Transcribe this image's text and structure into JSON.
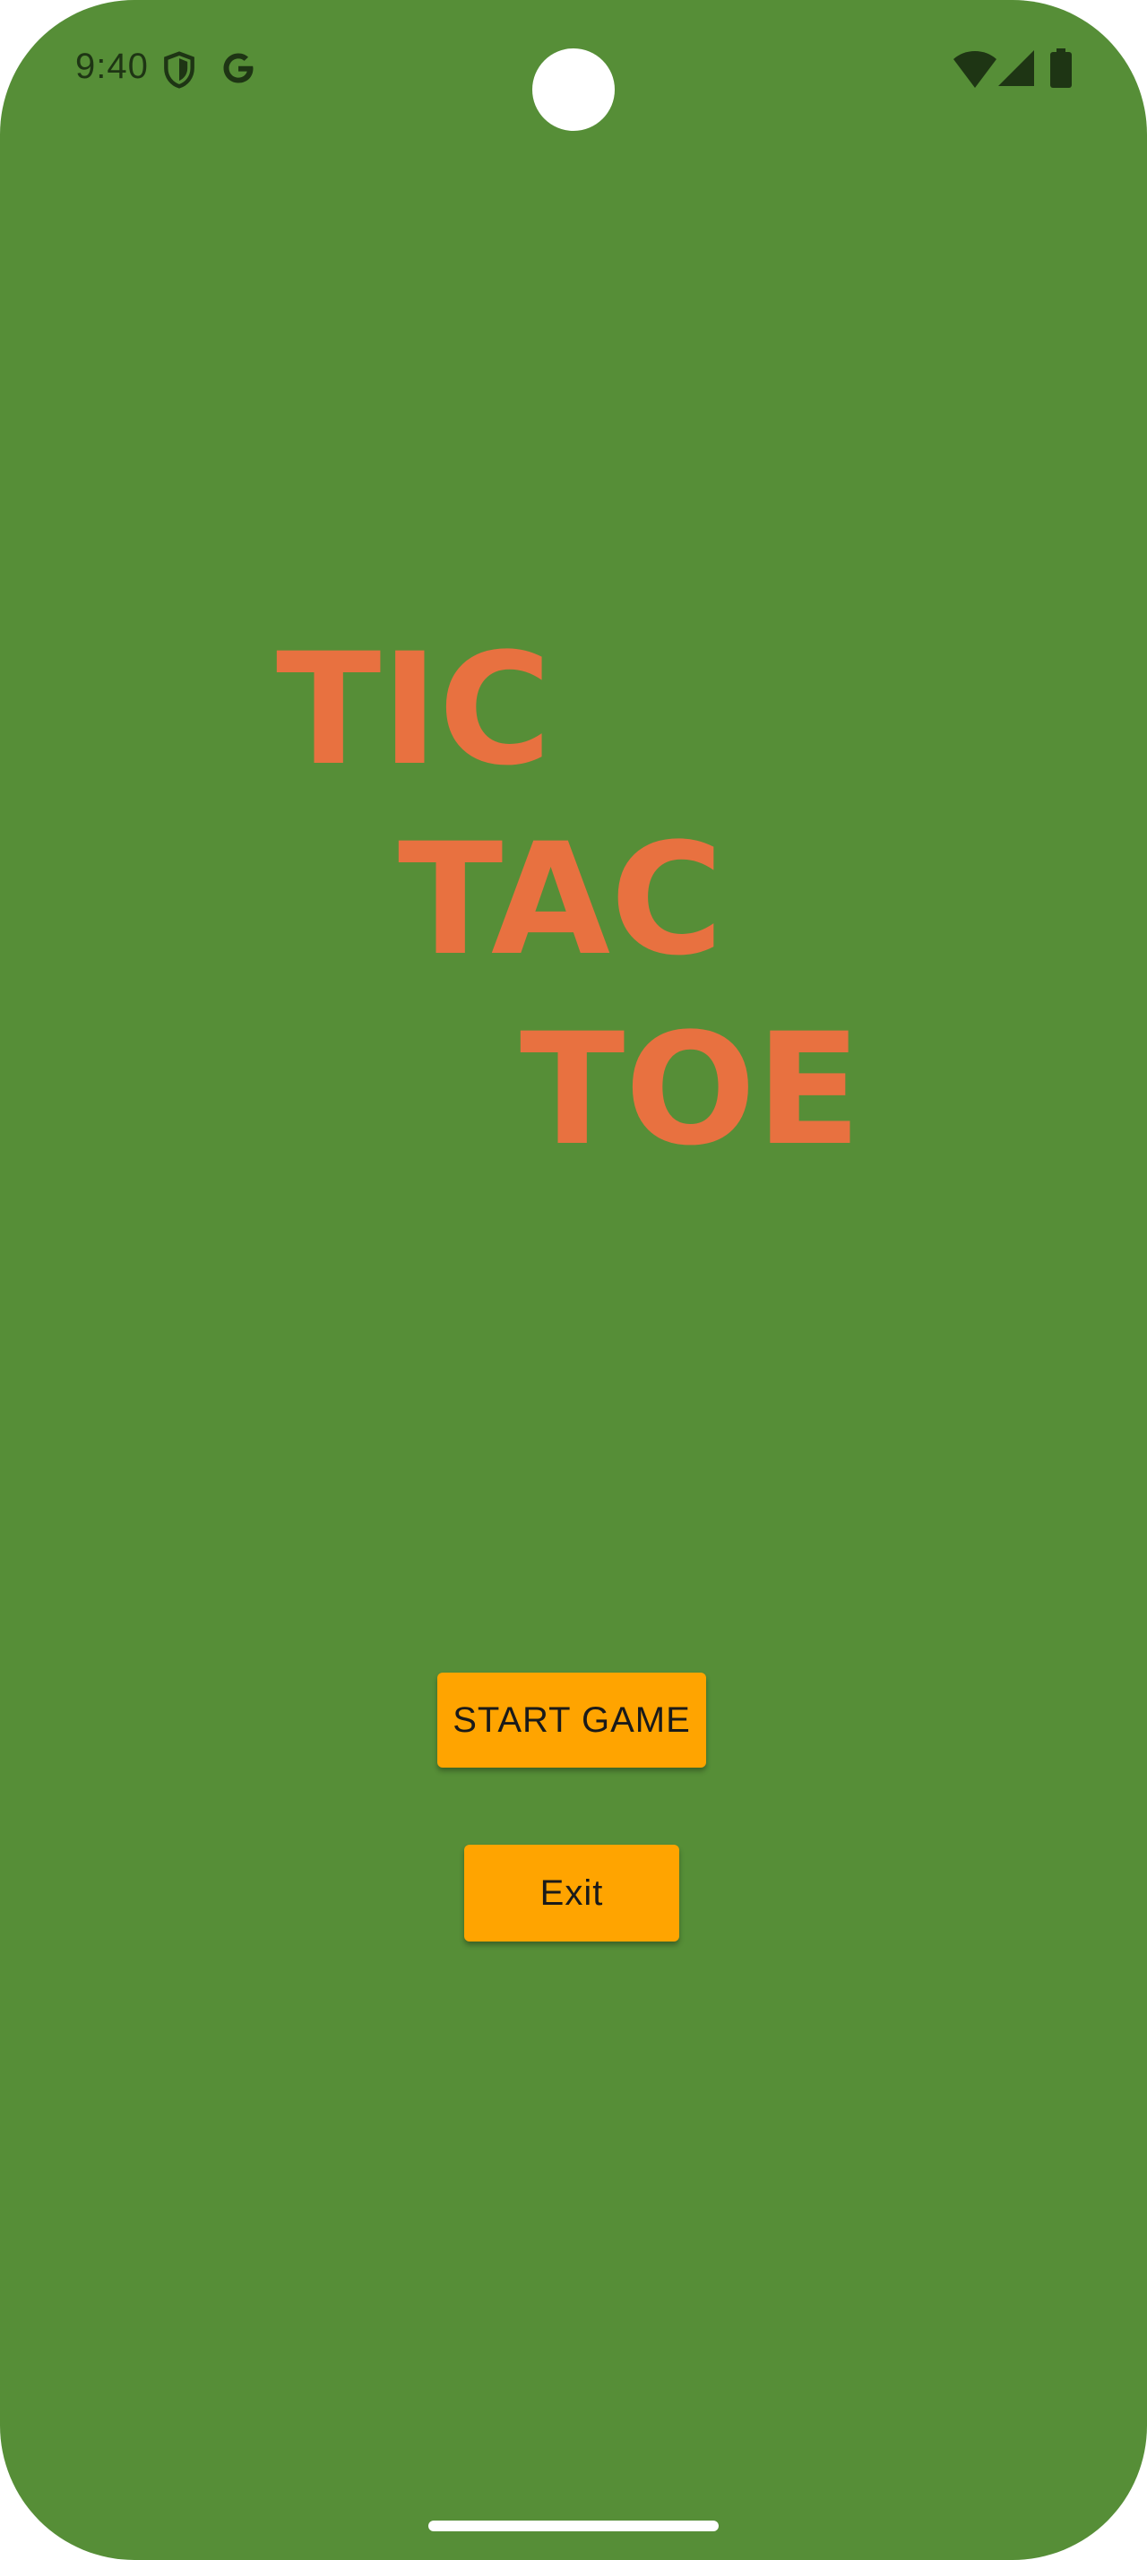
{
  "status_bar": {
    "time": "9:40",
    "icons": [
      "shield-icon",
      "google-g-icon",
      "wifi-icon",
      "cell-signal-icon",
      "battery-icon"
    ]
  },
  "title": {
    "line1": "TIC",
    "line2": "TAC",
    "line3": "TOE"
  },
  "buttons": {
    "start_label": "START GAME",
    "exit_label": "Exit"
  },
  "colors": {
    "background": "#568e37",
    "title": "#e87140",
    "button": "#ffa400"
  }
}
